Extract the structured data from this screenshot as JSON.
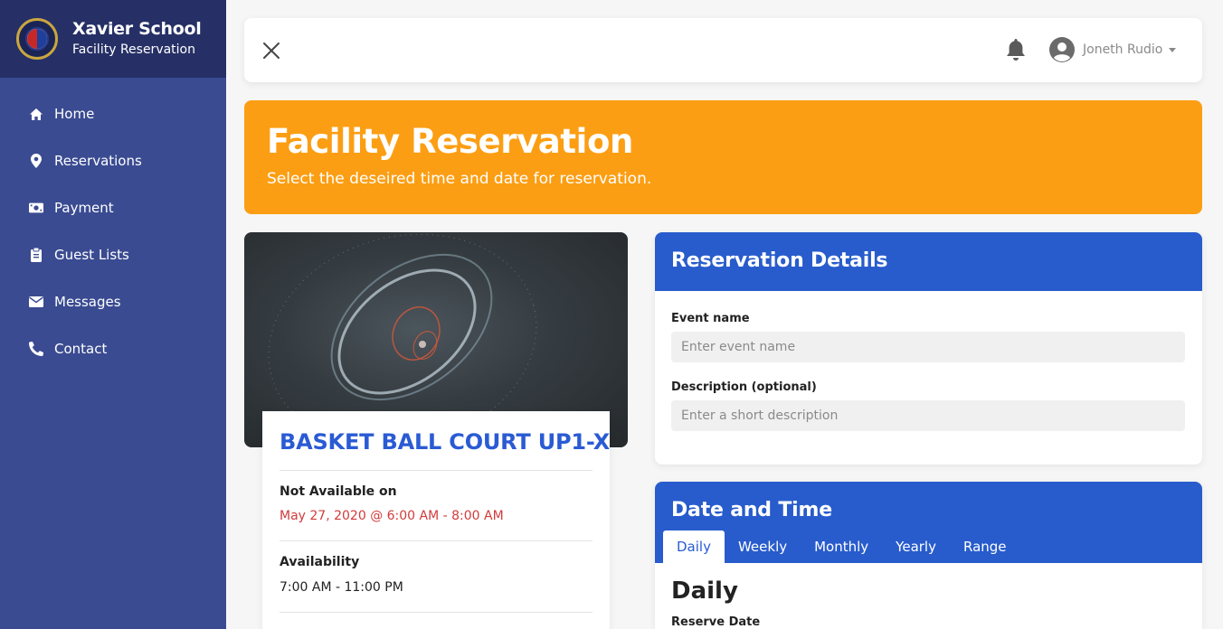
{
  "brand": {
    "title": "Xavier School",
    "subtitle": "Facility Reservation"
  },
  "sidebar": {
    "items": [
      {
        "label": "Home",
        "icon": "home-icon"
      },
      {
        "label": "Reservations",
        "icon": "map-pin-icon"
      },
      {
        "label": "Payment",
        "icon": "money-bill-icon"
      },
      {
        "label": "Guest Lists",
        "icon": "clipboard-icon"
      },
      {
        "label": "Messages",
        "icon": "envelope-icon"
      },
      {
        "label": "Contact",
        "icon": "phone-icon"
      }
    ]
  },
  "topbar": {
    "close_icon": "close-icon",
    "notification_icon": "bell-icon",
    "user_name": "Joneth Rudio"
  },
  "banner": {
    "title": "Facility Reservation",
    "subtitle": "Select the deseired time and date for reservation."
  },
  "facility": {
    "name": "BASKET BALL COURT UP1-X",
    "not_available_label": "Not Available on",
    "not_available_value": "May 27, 2020 @ 6:00 AM - 8:00 AM",
    "availability_label": "Availability",
    "availability_value": "7:00 AM - 11:00 PM"
  },
  "reservation_details": {
    "title": "Reservation Details",
    "event_name_label": "Event name",
    "event_name_placeholder": "Enter event name",
    "event_name_value": "",
    "description_label": "Description (optional)",
    "description_placeholder": "Enter a short description",
    "description_value": ""
  },
  "date_time": {
    "title": "Date and Time",
    "tabs": [
      "Daily",
      "Weekly",
      "Monthly",
      "Yearly",
      "Range"
    ],
    "active_tab": "Daily",
    "section_heading": "Daily",
    "reserve_date_label": "Reserve Date"
  },
  "colors": {
    "sidebar": "#3a4b91",
    "brand_bar": "#263066",
    "banner": "#fc9e13",
    "panel_header": "#285ccc",
    "accent_blue": "#2a5bd4",
    "unavailable_red": "#d23b3b"
  }
}
